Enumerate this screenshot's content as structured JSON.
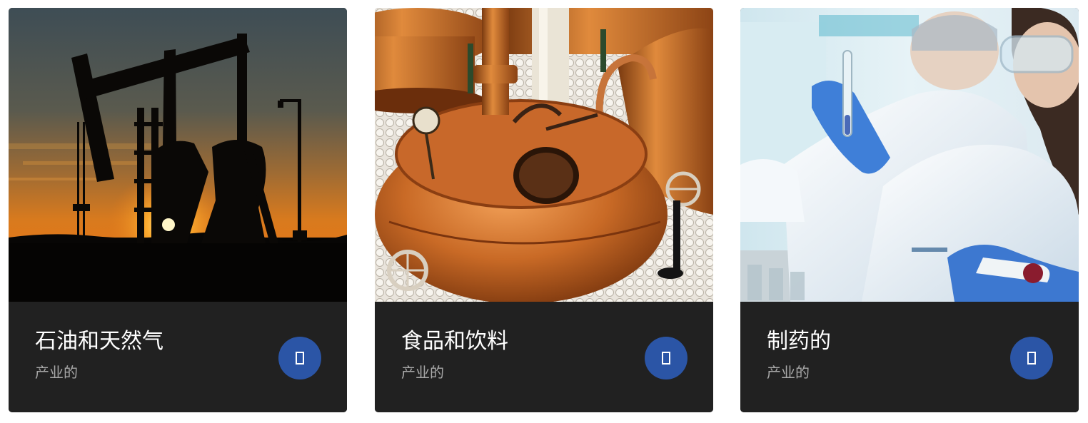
{
  "cards": [
    {
      "title": "石油和天然气",
      "subtitle": "产业的",
      "image": "oil-pumpjack-sunset-photo",
      "button_icon": "missing-glyph-icon"
    },
    {
      "title": "食品和饮料",
      "subtitle": "产业的",
      "image": "copper-brewing-kettles-photo",
      "button_icon": "missing-glyph-icon"
    },
    {
      "title": "制药的",
      "subtitle": "产业的",
      "image": "lab-scientists-test-tubes-photo",
      "button_icon": "missing-glyph-icon"
    }
  ],
  "colors": {
    "card_footer": "#212121",
    "title_text": "#ffffff",
    "subtitle_text": "#a8a8a8",
    "button_bg": "#2b55a6"
  }
}
